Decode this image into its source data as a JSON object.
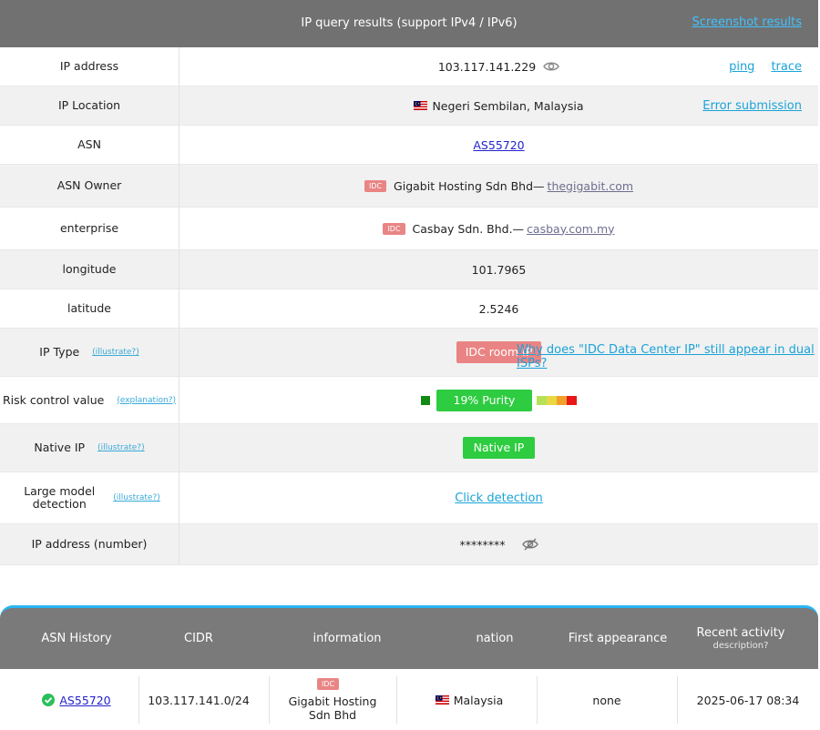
{
  "header": {
    "title": "IP query results (support IPv4 / IPv6)",
    "screenshot_link": "Screenshot results"
  },
  "rows": {
    "ip_address": {
      "label": "IP address",
      "value": "103.117.141.229",
      "ping": "ping",
      "trace": "trace"
    },
    "ip_location": {
      "label": "IP Location",
      "value": "Negeri Sembilan, Malaysia",
      "error_link": "Error submission"
    },
    "asn": {
      "label": "ASN",
      "value": "AS55720"
    },
    "asn_owner": {
      "label": "ASN Owner",
      "badge": "IDC",
      "name": "Gigabit Hosting Sdn Bhd—",
      "site": "thegigabit.com"
    },
    "enterprise": {
      "label": "enterprise",
      "badge": "IDC",
      "name": "Casbay Sdn. Bhd.—",
      "site": "casbay.com.my"
    },
    "longitude": {
      "label": "longitude",
      "value": "101.7965"
    },
    "latitude": {
      "label": "latitude",
      "value": "2.5246"
    },
    "ip_type": {
      "label": "IP Type",
      "help": "(illustrate?)",
      "badge": "IDC room IP",
      "question_link": "Why does \"IDC Data Center IP\" still appear in dual ISPs?"
    },
    "risk": {
      "label": "Risk control value",
      "help": "(explanation?)",
      "pill": "19%  Purity",
      "score_percent": 19
    },
    "native_ip": {
      "label": "Native IP",
      "help": "(illustrate?)",
      "value": "Native IP"
    },
    "llm_detection": {
      "label": "Large model detection",
      "help": "(illustrate?)",
      "link": "Click detection"
    },
    "ip_number": {
      "label": "IP address (number)",
      "value": "********"
    }
  },
  "history": {
    "columns": [
      "ASN History",
      "CIDR",
      "information",
      "nation",
      "First appearance",
      "Recent activity"
    ],
    "recent_sub": "description?",
    "entry": {
      "asn": "AS55720",
      "cidr": "103.117.141.0/24",
      "badge": "IDC",
      "info": "Gigabit Hosting Sdn Bhd",
      "nation": "Malaysia",
      "first": "none",
      "recent": "2025-06-17 08:34"
    }
  },
  "colors": {
    "header_bg": "#717171",
    "accent_blue": "#29b6f6",
    "idc_red": "#ea8484",
    "purity_green": "#2ecc40",
    "risk_bar": [
      "#b7e05a",
      "#e8d842",
      "#f2a02a",
      "#f06a2a",
      "#e81818"
    ]
  }
}
